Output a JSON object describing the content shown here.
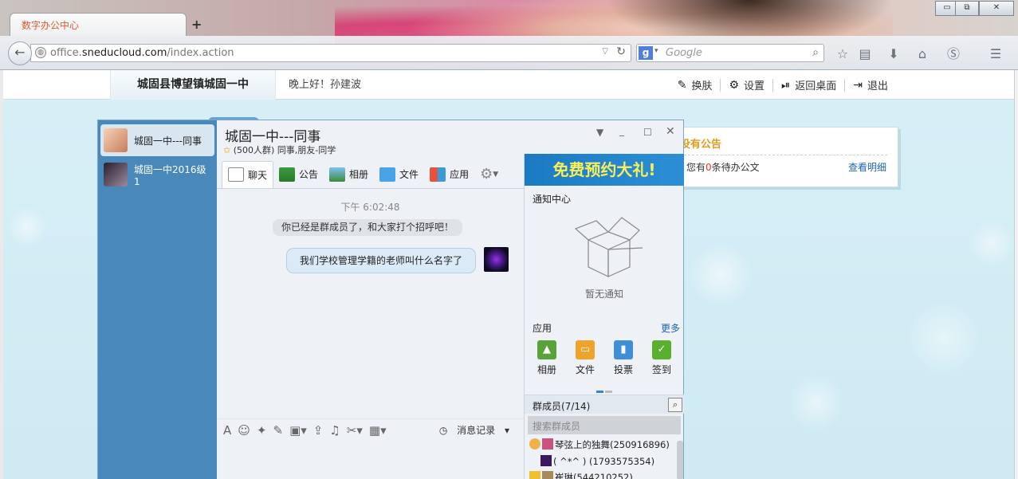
{
  "browser": {
    "tab_title": "数字办公中心",
    "new_tab": "+",
    "window_controls": [
      "▭",
      "⧉",
      "✕"
    ],
    "url_prefix": "office.",
    "url_domain": "sneducloud.com",
    "url_path": "/index.action",
    "search_engine_letter": "g",
    "search_placeholder": "Google"
  },
  "site": {
    "school_name": "城固县博望镇城固一中",
    "greeting": "晚上好！孙建波",
    "menu": [
      {
        "icon": "skin-icon",
        "label": "换肤"
      },
      {
        "icon": "gear-icon",
        "label": "设置"
      },
      {
        "icon": "desktop-icon",
        "label": "返回桌面"
      },
      {
        "icon": "logout-icon",
        "label": "退出"
      }
    ]
  },
  "notice": {
    "title": "没有公告",
    "text_prefix": "您有",
    "count": "0",
    "text_suffix": "条待办公文",
    "link": "查看明细"
  },
  "im": {
    "conversations": [
      {
        "name": "城固一中---同事",
        "active": true
      },
      {
        "name": "城固一中2016级1",
        "active": false
      }
    ],
    "group_title": "城固一中---同事",
    "group_count": "(500人群)",
    "group_tags": "同事,朋友-同学",
    "tabs": [
      "聊天",
      "公告",
      "相册",
      "文件",
      "应用"
    ],
    "chat": {
      "time": "下午 6:02:48",
      "system_message": "你已经是群成员了，和大家打个招呼吧！",
      "my_message": "我们学校管理学籍的老师叫什么名字了"
    },
    "history_label": "消息记录",
    "promo": "免费预约大礼!",
    "notify_center": "通知中心",
    "no_notice": "暂无通知",
    "apps_title": "应用",
    "apps_more": "更多",
    "apps": [
      {
        "label": "相册",
        "color": "#5aa33a"
      },
      {
        "label": "文件",
        "color": "#f0a32a"
      },
      {
        "label": "投票",
        "color": "#3f8fd8"
      },
      {
        "label": "签到",
        "color": "#5ab02e"
      }
    ],
    "members_title": "群成员(7/14)",
    "member_search_placeholder": "搜索群成员",
    "members": [
      "琴弦上的独舞(250916896)",
      "( ^*^ ) (1793575354)",
      "崔琳(544210252)"
    ]
  }
}
